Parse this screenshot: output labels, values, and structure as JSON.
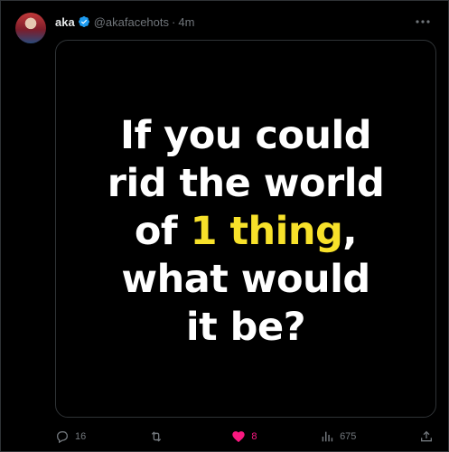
{
  "author": {
    "name": "aka",
    "handle": "@akafacehots",
    "separator": "·",
    "time": "4m",
    "avatar_icon": "avatar"
  },
  "poster": {
    "line1": "If you could",
    "line2": "rid the world",
    "line3_prefix": "of ",
    "line3_highlight": "1 thing",
    "line3_suffix": ",",
    "line4": "what would",
    "line5": "it be?",
    "text_color": "#ffffff",
    "highlight_color": "#f7e12a",
    "background": "#000000"
  },
  "actions": {
    "reply_count": "16",
    "retweet_count": "",
    "like_count": "8",
    "views_count": "675",
    "like_color": "#f91880",
    "muted_color": "#71767b"
  },
  "colors": {
    "verified": "#1d9bf0",
    "border": "#2f3336"
  }
}
